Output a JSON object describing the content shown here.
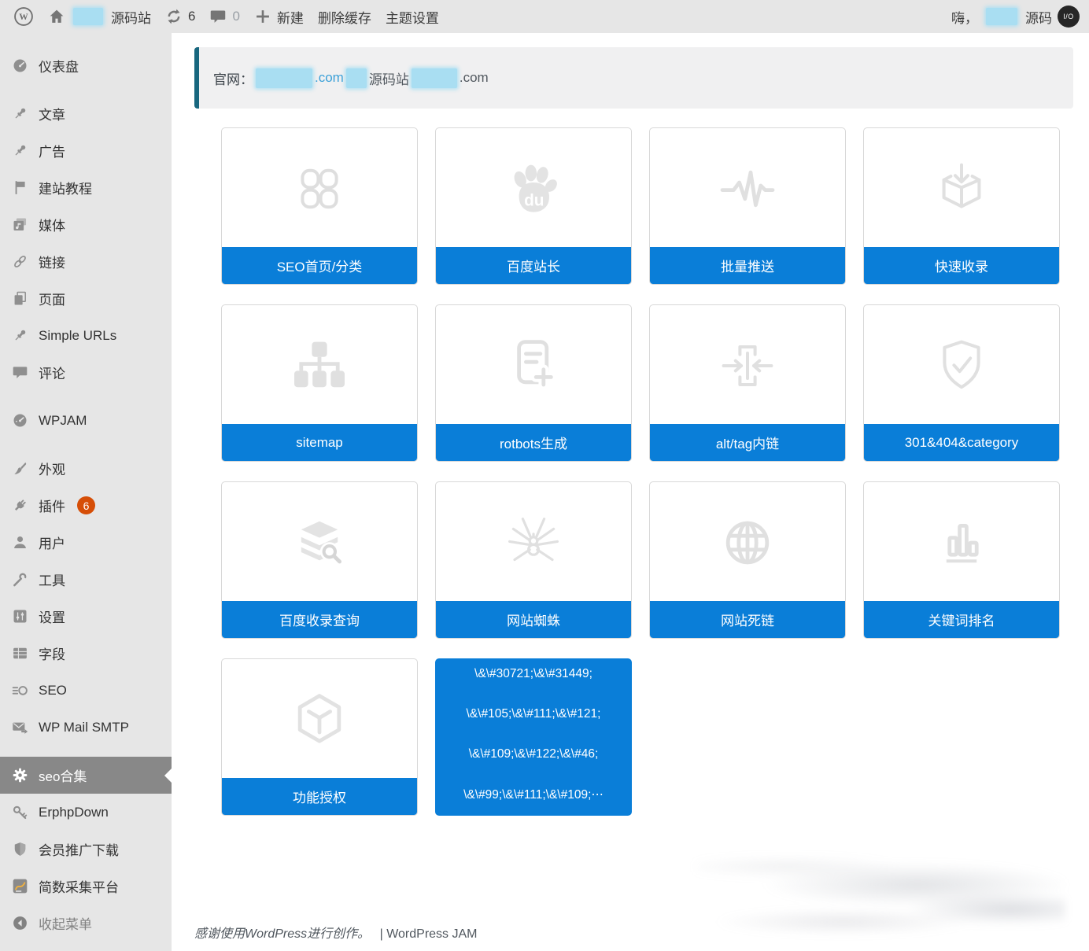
{
  "admin_bar": {
    "site_name": "源码站",
    "updates_count": "6",
    "comments_count": "0",
    "new_label": "新建",
    "clear_cache_label": "删除缓存",
    "theme_settings_label": "主题设置",
    "greeting": "嗨，",
    "user_name": "源码",
    "avatar_text": "I/O"
  },
  "sidebar": {
    "items": [
      {
        "id": "dashboard",
        "label": "仪表盘",
        "icon": "dashboard-icon"
      },
      {
        "id": "posts",
        "label": "文章",
        "icon": "pin-icon",
        "separator_before": true
      },
      {
        "id": "ads",
        "label": "广告",
        "icon": "pin-icon"
      },
      {
        "id": "site-tutorials",
        "label": "建站教程",
        "icon": "flag-icon"
      },
      {
        "id": "media",
        "label": "媒体",
        "icon": "media-icon"
      },
      {
        "id": "links",
        "label": "链接",
        "icon": "link-icon"
      },
      {
        "id": "pages",
        "label": "页面",
        "icon": "pages-icon"
      },
      {
        "id": "simple-urls",
        "label": "Simple URLs",
        "icon": "pin-icon"
      },
      {
        "id": "comments",
        "label": "评论",
        "icon": "comment-icon"
      },
      {
        "id": "wpjam",
        "label": "WPJAM",
        "icon": "gauge-icon",
        "separator_before": true
      },
      {
        "id": "appearance",
        "label": "外观",
        "icon": "brush-icon",
        "separator_before": true
      },
      {
        "id": "plugins",
        "label": "插件",
        "icon": "plugin-icon",
        "badge": "6"
      },
      {
        "id": "users",
        "label": "用户",
        "icon": "user-icon"
      },
      {
        "id": "tools",
        "label": "工具",
        "icon": "wrench-icon"
      },
      {
        "id": "settings",
        "label": "设置",
        "icon": "settings-icon"
      },
      {
        "id": "fields",
        "label": "字段",
        "icon": "table-icon"
      },
      {
        "id": "seo",
        "label": "SEO",
        "icon": "seo-icon"
      },
      {
        "id": "wp-mail-smtp",
        "label": "WP Mail SMTP",
        "icon": "mail-icon"
      },
      {
        "id": "seo-collection",
        "label": "seo合集",
        "icon": "gear-icon",
        "active": true,
        "separator_before": true
      },
      {
        "id": "erphpdown",
        "label": "ErphpDown",
        "icon": "key-icon"
      },
      {
        "id": "member-promo-download",
        "label": "会员推广下载",
        "icon": "shield-icon"
      },
      {
        "id": "jianshu-collect",
        "label": "简数采集平台",
        "icon": "collect-icon"
      },
      {
        "id": "collapse-menu",
        "label": "收起菜单",
        "icon": "collapse-icon",
        "dim": true
      }
    ]
  },
  "notice": {
    "label": "官网：",
    "link_domain_suffix": ".com",
    "site_text": "源码站",
    "tail_suffix": ".com"
  },
  "cards": [
    {
      "id": "seo-home-category",
      "label": "SEO首页/分类",
      "icon": "clover-icon"
    },
    {
      "id": "baidu-webmaster",
      "label": "百度站长",
      "icon": "baidu-paw-icon"
    },
    {
      "id": "batch-push",
      "label": "批量推送",
      "icon": "pulse-icon"
    },
    {
      "id": "fast-indexing",
      "label": "快速收录",
      "icon": "box-receive-icon"
    },
    {
      "id": "sitemap",
      "label": "sitemap",
      "icon": "sitemap-icon"
    },
    {
      "id": "robots-generate",
      "label": "rotbots生成",
      "icon": "file-plus-icon"
    },
    {
      "id": "alt-tag-innerlink",
      "label": "alt/tag内链",
      "icon": "compress-icon"
    },
    {
      "id": "redirect-404-category",
      "label": "301&404&category",
      "icon": "shield-check-icon"
    },
    {
      "id": "baidu-index-query",
      "label": "百度收录查询",
      "icon": "layers-search-icon"
    },
    {
      "id": "site-spider",
      "label": "网站蜘蛛",
      "icon": "spider-icon"
    },
    {
      "id": "dead-links",
      "label": "网站死链",
      "icon": "globe-icon"
    },
    {
      "id": "keyword-ranking",
      "label": "关键词排名",
      "icon": "bar-chart-icon"
    },
    {
      "id": "feature-license",
      "label": "功能授权",
      "icon": "cube-y-icon"
    },
    {
      "id": "escaped-entities",
      "type": "escaped",
      "lines": [
        "\\&\\#30721;\\&\\#31449;",
        "\\&\\#105;\\&\\#111;\\&\\#121;",
        "\\&\\#109;\\&\\#122;\\&\\#46;",
        "\\&\\#99;\\&\\#111;\\&\\#109;⋯"
      ]
    }
  ],
  "footer": {
    "thanks": "感谢使用WordPress进行创作。",
    "separator": "|",
    "credit": "WordPress JAM"
  },
  "colors": {
    "accent_blue": "#0a7ed8",
    "notice_border": "#17667e",
    "badge_orange": "#d64e07",
    "active_gray": "#888888",
    "chrome_gray": "#e6e6e6"
  }
}
